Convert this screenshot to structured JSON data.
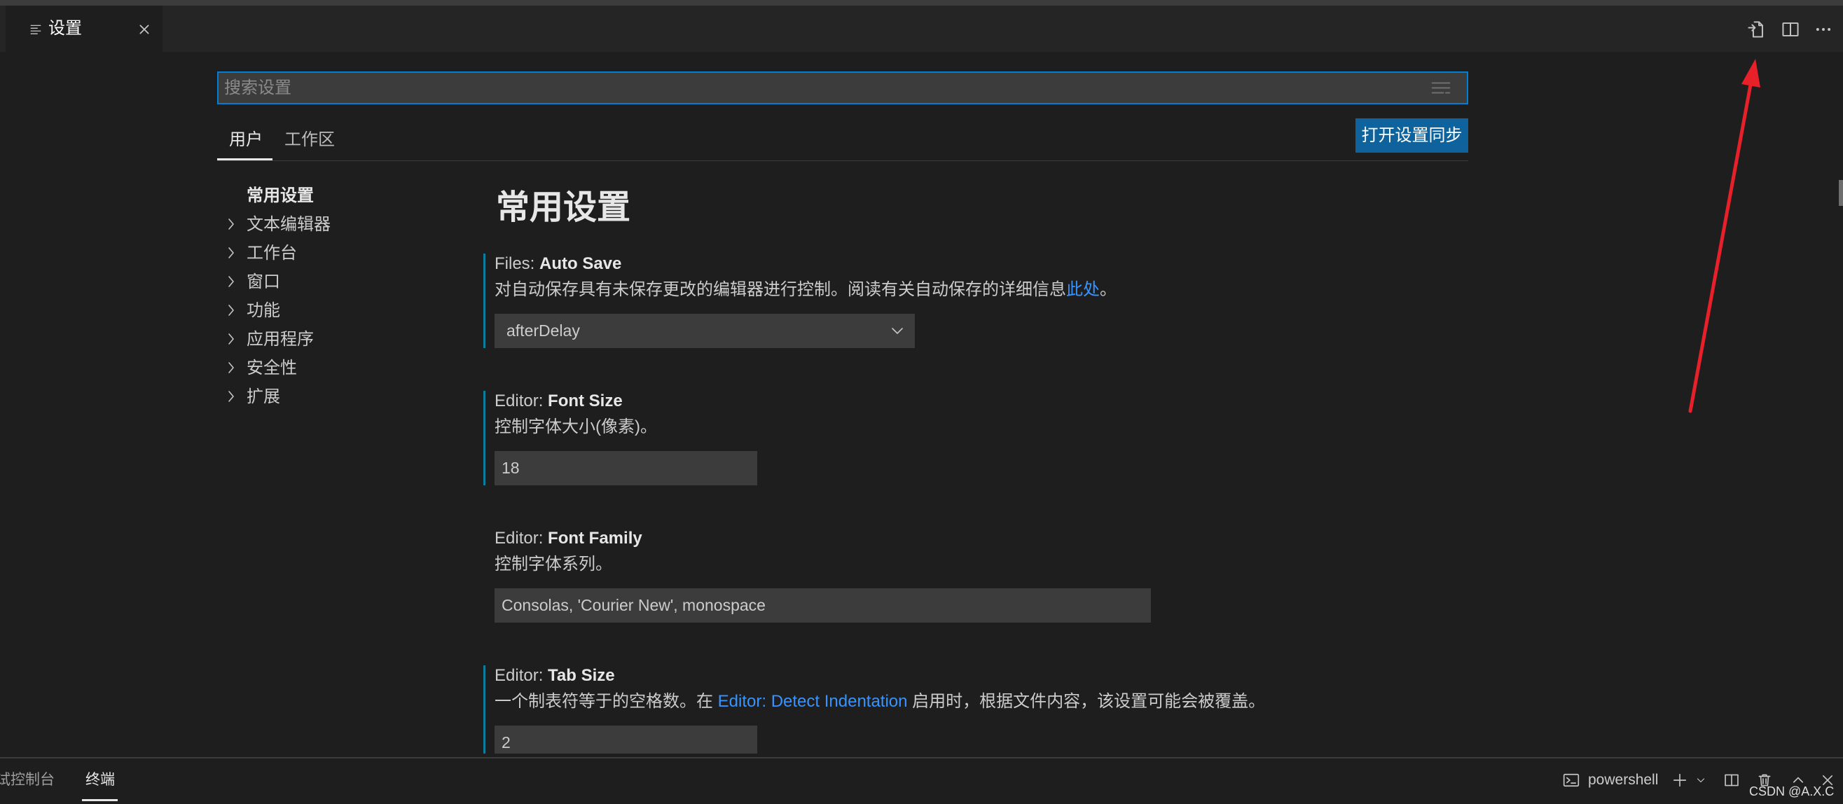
{
  "colors": {
    "focusBorder": "#007fd4",
    "buttonBg": "#0e639c",
    "link": "#3794ff",
    "modified": "#0c7d9d",
    "annotation": "#e8202a"
  },
  "editor_tab": {
    "title": "设置",
    "icon": "list-icon",
    "close_icon": "close-icon"
  },
  "editor_actions": [
    "open-settings-json-icon",
    "split-editor-icon",
    "more-actions-icon"
  ],
  "search": {
    "placeholder": "搜索设置",
    "value": "",
    "icon": "filter-icon"
  },
  "scope_tabs": [
    {
      "label": "用户",
      "active": true
    },
    {
      "label": "工作区",
      "active": false
    }
  ],
  "sync_button": {
    "label": "打开设置同步"
  },
  "toc": {
    "items": [
      {
        "label": "常用设置",
        "selected": true,
        "expandable": false
      },
      {
        "label": "文本编辑器",
        "selected": false,
        "expandable": true
      },
      {
        "label": "工作台",
        "selected": false,
        "expandable": true
      },
      {
        "label": "窗口",
        "selected": false,
        "expandable": true
      },
      {
        "label": "功能",
        "selected": false,
        "expandable": true
      },
      {
        "label": "应用程序",
        "selected": false,
        "expandable": true
      },
      {
        "label": "安全性",
        "selected": false,
        "expandable": true
      },
      {
        "label": "扩展",
        "selected": false,
        "expandable": true
      }
    ]
  },
  "section": {
    "title": "常用设置"
  },
  "settings": [
    {
      "category": "Files: ",
      "name": "Auto Save",
      "modified": true,
      "description": "对自动保存具有未保存更改的编辑器进行控制。阅读有关自动保存的详细信息",
      "link": "此处",
      "description_end": "。",
      "value": "afterDelay"
    },
    {
      "category": "Editor: ",
      "name": "Font Size",
      "modified": true,
      "description": "控制字体大小(像素)。",
      "value": "18"
    },
    {
      "category": "Editor: ",
      "name": "Font Family",
      "modified": false,
      "description": "控制字体系列。",
      "value": "Consolas, 'Courier New', monospace"
    },
    {
      "category": "Editor: ",
      "name": "Tab Size",
      "modified": true,
      "description": "一个制表符等于的空格数。在 ",
      "link": "Editor: Detect Indentation",
      "description_end": " 启用时，根据文件内容，该设置可能会被覆盖。",
      "value": "2"
    }
  ],
  "panel": {
    "tabs": [
      {
        "label": "试控制台",
        "active": false
      },
      {
        "label": "终端",
        "active": true
      }
    ],
    "terminal_name": "powershell",
    "actions": [
      "terminal-icon",
      "plus-icon",
      "chevron-down-icon",
      "split-terminal-icon",
      "trash-icon",
      "chevron-up-icon",
      "close-icon"
    ]
  },
  "watermark": "CSDN @A.X.C"
}
